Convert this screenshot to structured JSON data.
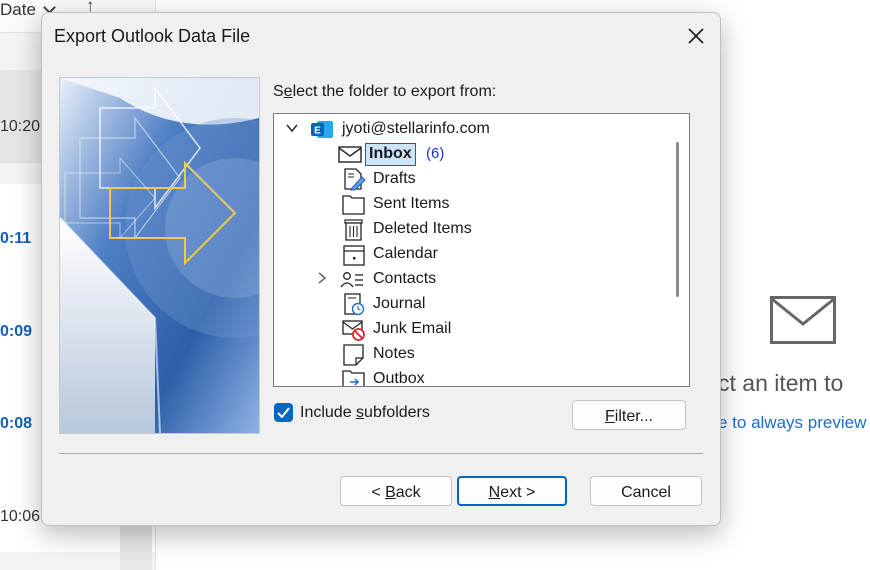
{
  "background": {
    "sort_label": "Date",
    "sort_arrow": "↑",
    "times": [
      "10:20",
      "0:11",
      "0:09",
      "0:08",
      "10:06"
    ],
    "preview_text": "ct an item to",
    "preview_link": "e to always preview"
  },
  "dialog": {
    "title": "Export Outlook Data File",
    "folder_label_pre": "S",
    "folder_label_underline": "e",
    "folder_label_post": "lect the folder to export from:",
    "account": "jyoti@stellarinfo.com",
    "folders": [
      {
        "label": "Inbox",
        "icon": "envelope-icon",
        "unread": "(6)"
      },
      {
        "label": "Drafts",
        "icon": "drafts-icon"
      },
      {
        "label": "Sent Items",
        "icon": "sent-folder-icon"
      },
      {
        "label": "Deleted Items",
        "icon": "trash-icon"
      },
      {
        "label": "Calendar",
        "icon": "calendar-icon"
      },
      {
        "label": "Contacts",
        "icon": "contacts-icon"
      },
      {
        "label": "Journal",
        "icon": "journal-icon"
      },
      {
        "label": "Junk Email",
        "icon": "junk-icon"
      },
      {
        "label": "Notes",
        "icon": "notes-icon"
      },
      {
        "label": "Outbox",
        "icon": "outbox-icon"
      }
    ],
    "include_subfolders_pre": "Include ",
    "include_subfolders_underline": "s",
    "include_subfolders_post": "ubfolders",
    "include_subfolders_checked": true,
    "filter_label_underline": "F",
    "filter_label_post": "ilter...",
    "back_label_pre": "< ",
    "back_label_underline": "B",
    "back_label_post": "ack",
    "next_label_underline": "N",
    "next_label_post": "ext >",
    "cancel_label": "Cancel"
  },
  "colors": {
    "accent": "#0067c0",
    "selection": "#cce4f7",
    "unread": "#1b35d4"
  }
}
